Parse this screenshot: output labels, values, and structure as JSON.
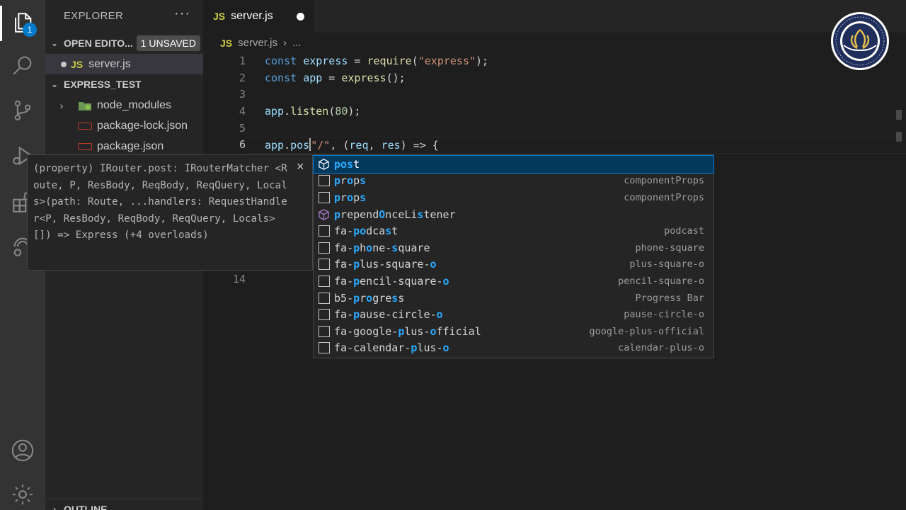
{
  "activity_bar": {
    "explorer_badge": "1",
    "icons": [
      "files-icon",
      "search-icon",
      "source-control-icon",
      "run-debug-icon",
      "extensions-icon",
      "remote-explorer-icon",
      "account-icon",
      "settings-gear-icon"
    ]
  },
  "sidebar": {
    "title": "EXPLORER",
    "more": "···",
    "open_editors": {
      "label": "OPEN EDITO...",
      "badge": "1 UNSAVED",
      "items": [
        {
          "type": "JS",
          "name": "server.js"
        }
      ]
    },
    "project": {
      "label": "EXPRESS_TEST",
      "items": [
        {
          "name": "node_modules",
          "kind": "folder"
        },
        {
          "name": "package-lock.json",
          "kind": "json"
        },
        {
          "name": "package.json",
          "kind": "json"
        }
      ]
    },
    "outline_label": "OUTLINE"
  },
  "tab": {
    "type": "JS",
    "name": "server.js"
  },
  "breadcrumb": {
    "type": "JS",
    "file": "server.js",
    "more": "..."
  },
  "gutter": {
    "lines": [
      "1",
      "2",
      "3",
      "4",
      "5",
      "6",
      "14"
    ]
  },
  "code": {
    "line1": {
      "kw": "const",
      "name": "express",
      "eq": " = ",
      "fn": "require",
      "open": "(",
      "str": "\"express\"",
      "close": ");"
    },
    "line2": {
      "kw": "const",
      "name": "app",
      "eq": " = ",
      "fn": "express",
      "rest": "();"
    },
    "line4": {
      "obj": "app",
      "dot": ".",
      "fn": "listen",
      "open": "(",
      "num": "80",
      "close": ");"
    },
    "line6": {
      "obj": "app",
      "dot": ".",
      "typed": "pos",
      "after": "\"/\"",
      "comma": ", (",
      "p1": "req",
      "sep": ", ",
      "p2": "res",
      "arrow": ") => {",
      "paren": "("
    }
  },
  "hover": {
    "text": "(property) IRouter.post: IRouterMatcher <Route, P, ResBody, ReqBody, ReqQuery, Locals>(path: Route, ...handlers: RequestHandler<P, ResBody, ReqBody, ReqQuery, Locals>[]) => Express (+4 overloads)",
    "close": "×"
  },
  "suggestions": [
    {
      "icon": "cube-icon",
      "label": "post",
      "detail": ""
    },
    {
      "icon": "snippet-box-icon",
      "label": "props",
      "detail": "componentProps"
    },
    {
      "icon": "snippet-box-icon",
      "label": "props",
      "detail": "componentProps"
    },
    {
      "icon": "method-icon",
      "label": "prependOnceListener",
      "detail": ""
    },
    {
      "icon": "snippet-box-icon",
      "label": "fa-podcast",
      "detail": "podcast"
    },
    {
      "icon": "snippet-box-icon",
      "label": "fa-phone-square",
      "detail": "phone-square"
    },
    {
      "icon": "snippet-box-icon",
      "label": "fa-plus-square-o",
      "detail": "plus-square-o"
    },
    {
      "icon": "snippet-box-icon",
      "label": "fa-pencil-square-o",
      "detail": "pencil-square-o"
    },
    {
      "icon": "snippet-box-icon",
      "label": "b5-progress",
      "detail": "Progress Bar"
    },
    {
      "icon": "snippet-box-icon",
      "label": "fa-pause-circle-o",
      "detail": "pause-circle-o"
    },
    {
      "icon": "snippet-box-icon",
      "label": "fa-google-plus-official",
      "detail": "google-plus-official"
    },
    {
      "icon": "snippet-box-icon",
      "label": "fa-calendar-plus-o",
      "detail": "calendar-plus-o"
    }
  ],
  "highlight_query": "pos",
  "colors": {
    "accent": "#007acc",
    "highlight": "#2aaaff",
    "selected_row": "#04395e"
  }
}
